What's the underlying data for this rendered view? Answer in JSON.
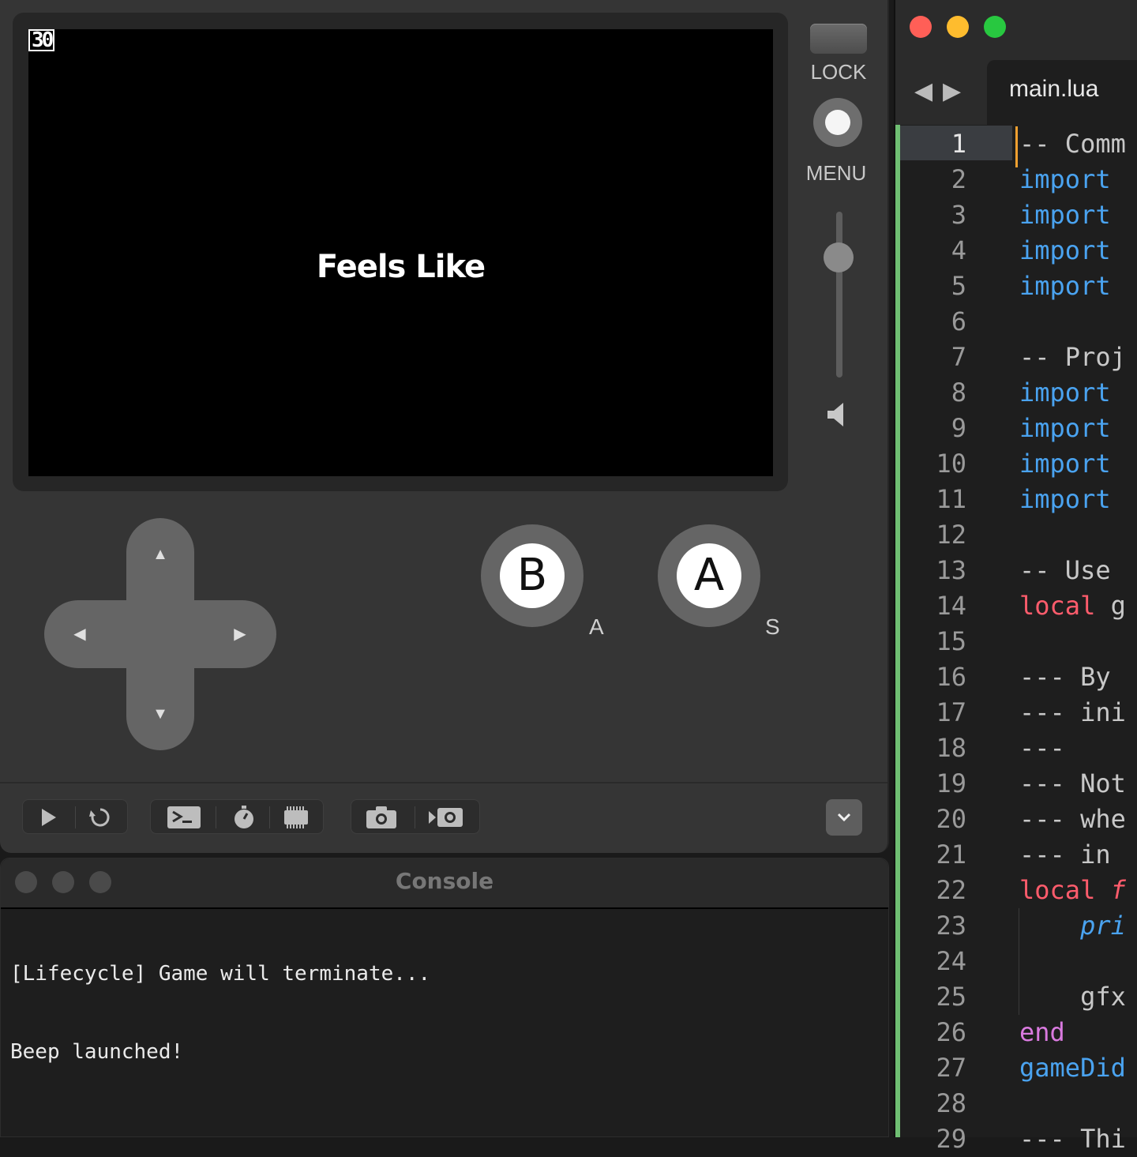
{
  "simulator": {
    "fps": "30",
    "screen_text": "Feels Like",
    "lock_label": "LOCK",
    "menu_label": "MENU",
    "volume_level": 0.75,
    "buttons": {
      "b": "B",
      "a": "A",
      "b_key": "A",
      "a_key": "S"
    },
    "dpad": {
      "up": "▲",
      "down": "▼",
      "left": "◀",
      "right": "▶"
    },
    "toolbar": {
      "play": "play-icon",
      "restart": "restart-icon",
      "console": "console-icon",
      "timer": "stopwatch-icon",
      "device": "device-icon",
      "screenshot": "camera-icon",
      "record": "record-icon",
      "collapse": "chevron-down-icon"
    }
  },
  "console": {
    "title": "Console",
    "lines": [
      "[Lifecycle] Game will terminate...",
      "Beep launched!"
    ]
  },
  "editor": {
    "tab": "main.lua",
    "colors": {
      "import": "#4aa3f0",
      "local": "#ff5c6c",
      "end": "#d97adf",
      "gutter": "#6fbf73",
      "cursor": "#f0a030"
    },
    "lines": [
      {
        "n": "1",
        "t": "-- Comm",
        "c": "comment"
      },
      {
        "n": "2",
        "t": "import",
        "c": "import"
      },
      {
        "n": "3",
        "t": "import",
        "c": "import"
      },
      {
        "n": "4",
        "t": "import",
        "c": "import"
      },
      {
        "n": "5",
        "t": "import",
        "c": "import"
      },
      {
        "n": "6",
        "t": "",
        "c": ""
      },
      {
        "n": "7",
        "t": "-- Proj",
        "c": "comment"
      },
      {
        "n": "8",
        "t": "import",
        "c": "import"
      },
      {
        "n": "9",
        "t": "import",
        "c": "import"
      },
      {
        "n": "10",
        "t": "import",
        "c": "import"
      },
      {
        "n": "11",
        "t": "import",
        "c": "import"
      },
      {
        "n": "12",
        "t": "",
        "c": ""
      },
      {
        "n": "13",
        "t": "-- Use",
        "c": "comment"
      },
      {
        "n": "14",
        "t": "local g",
        "c": "local"
      },
      {
        "n": "15",
        "t": "",
        "c": ""
      },
      {
        "n": "16",
        "t": "--- By",
        "c": "comment"
      },
      {
        "n": "17",
        "t": "--- ini",
        "c": "comment"
      },
      {
        "n": "18",
        "t": "---",
        "c": "comment"
      },
      {
        "n": "19",
        "t": "--- Not",
        "c": "comment"
      },
      {
        "n": "20",
        "t": "--- whe",
        "c": "comment"
      },
      {
        "n": "21",
        "t": "--- in",
        "c": "comment"
      },
      {
        "n": "22",
        "t": "local f",
        "c": "localf"
      },
      {
        "n": "23",
        "t": "    pri",
        "c": "print"
      },
      {
        "n": "24",
        "t": "",
        "c": ""
      },
      {
        "n": "25",
        "t": "    gfx",
        "c": "plain"
      },
      {
        "n": "26",
        "t": "end",
        "c": "end"
      },
      {
        "n": "27",
        "t": "gameDid",
        "c": "ident"
      },
      {
        "n": "28",
        "t": "",
        "c": ""
      },
      {
        "n": "29",
        "t": "--- Thi",
        "c": "comment"
      }
    ]
  }
}
